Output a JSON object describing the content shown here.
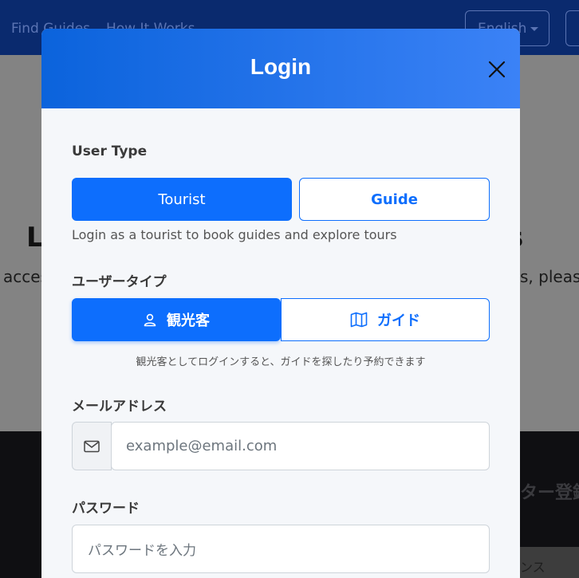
{
  "background": {
    "nav": {
      "find_guides": "Find Guides",
      "how_it_works": "How It Works",
      "language": "English"
    },
    "hero": {
      "heading_left": "L",
      "heading_right": "s",
      "subtitle_left": "acces",
      "subtitle_right": "s, please"
    },
    "footer": {
      "title": "ター登録",
      "small": "ンス"
    }
  },
  "modal": {
    "title": "Login",
    "user_type_en": {
      "label": "User Type",
      "tourist": "Tourist",
      "guide": "Guide",
      "help": "Login as a tourist to book guides and explore tours"
    },
    "user_type_ja": {
      "label": "ユーザータイプ",
      "tourist": "観光客",
      "guide": "ガイド",
      "help": "観光客としてログインすると、ガイドを探したり予約できます"
    },
    "email": {
      "label": "メールアドレス",
      "placeholder": "example@email.com"
    },
    "password": {
      "label": "パスワード",
      "placeholder": "パスワードを入力"
    }
  },
  "colors": {
    "primary": "#0d6efd",
    "header_start": "#0b63dc",
    "header_end": "#3b82f6"
  }
}
